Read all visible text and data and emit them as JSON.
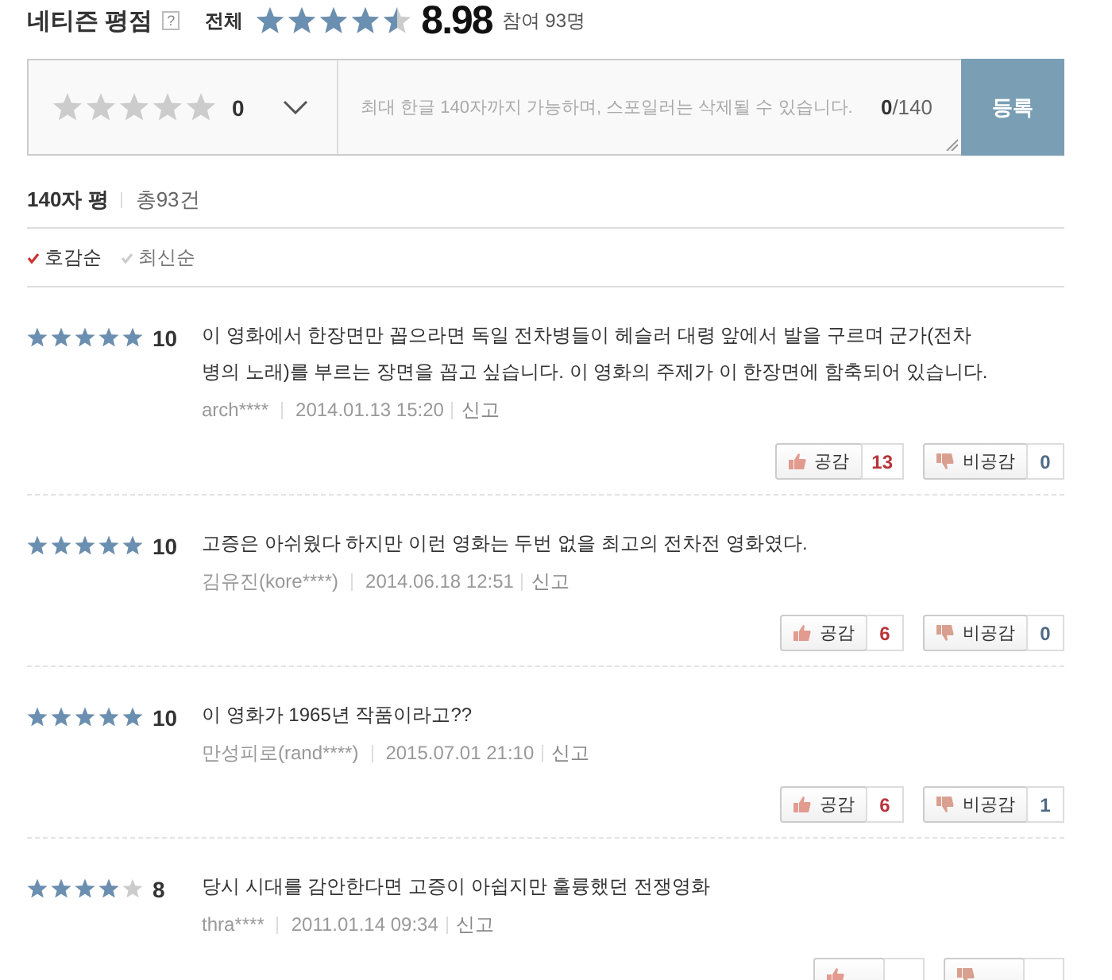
{
  "header": {
    "title": "네티즌 평점",
    "help": "?",
    "total_label": "전체",
    "stars": 4.5,
    "score": "8.98",
    "participants": "참여 93명"
  },
  "form": {
    "stars": 0,
    "score": "0",
    "placeholder": "최대 한글 140자까지 가능하며, 스포일러는 삭제될 수 있습니다.",
    "count": "0",
    "limit": "/140",
    "submit": "등록"
  },
  "summary": {
    "title": "140자 평",
    "total": "총93건"
  },
  "sort_options": [
    {
      "label": "호감순",
      "selected": true
    },
    {
      "label": "최신순",
      "selected": false
    }
  ],
  "reviews": [
    {
      "stars": 5,
      "score": "10",
      "text": "이 영화에서 한장면만 꼽으라면 독일 전차병들이 헤슬러 대령 앞에서 발을 구르며 군가(전차병의 노래)를 부르는 장면을 꼽고 싶습니다. 이 영화의 주제가 이 한장면에 함축되어 있습니다.",
      "author": "arch****",
      "date": "2014.01.13 15:20",
      "report": "신고",
      "like_label": "공감",
      "likes": "13",
      "dislike_label": "비공감",
      "dislikes": "0"
    },
    {
      "stars": 5,
      "score": "10",
      "text": "고증은 아쉬웠다 하지만 이런 영화는 두번 없을 최고의 전차전 영화였다.",
      "author": "김유진(kore****)",
      "date": "2014.06.18 12:51",
      "report": "신고",
      "like_label": "공감",
      "likes": "6",
      "dislike_label": "비공감",
      "dislikes": "0"
    },
    {
      "stars": 5,
      "score": "10",
      "text": "이 영화가 1965년 작품이라고??",
      "author": "만성피로(rand****)",
      "date": "2015.07.01 21:10",
      "report": "신고",
      "like_label": "공감",
      "likes": "6",
      "dislike_label": "비공감",
      "dislikes": "1"
    },
    {
      "stars": 4,
      "score": "8",
      "text": "당시 시대를 감안한다면 고증이 아쉽지만 훌륭했던 전쟁영화",
      "author": "thra****",
      "date": "2011.01.14 09:34",
      "report": "신고"
    }
  ]
}
